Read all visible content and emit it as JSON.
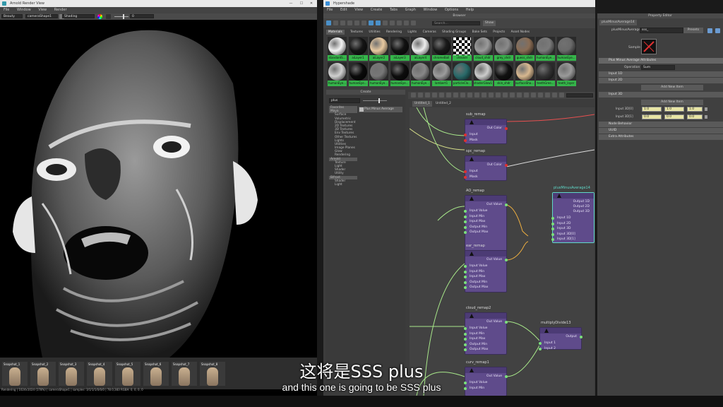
{
  "left_window": {
    "title": "Arnold Render View",
    "menu": [
      "File",
      "Window",
      "View",
      "Render"
    ],
    "toolbar": {
      "aov": "Beauty",
      "camera": "cameraShape1",
      "shading": "Shading",
      "exposure": "0"
    },
    "status": "Rendering | 1024x1024 (178%) | cameraShape1 | samples: 3/1/1/1/0/0/0 | 78.0,383 RGBA: 0, 0, 0, 0",
    "snapshots": [
      "Snapshot_1",
      "Snapshot_2",
      "Snapshot_3",
      "Snapshot_4",
      "Snapshot_5",
      "Snapshot_6",
      "Snapshot_7",
      "Snapshot_8"
    ]
  },
  "hypershade": {
    "title": "Hypershade",
    "menu": [
      "File",
      "Edit",
      "View",
      "Create",
      "Tabs",
      "Graph",
      "Window",
      "Options",
      "Help"
    ],
    "browser_title": "Browser",
    "browser_tabs": [
      "Materials",
      "Textures",
      "Utilities",
      "Rendering",
      "Lights",
      "Cameras",
      "Shading Groups",
      "Bake Sets",
      "Projects",
      "Asset Nodes"
    ],
    "search_placeholder": "Search...",
    "show_label": "Show",
    "swatches": [
      {
        "label": "standardS...",
        "color": "#f4f4f4"
      },
      {
        "label": "aiLayer1",
        "color": "#151515"
      },
      {
        "label": "aiLayer2",
        "color": "#e8c9a0"
      },
      {
        "label": "aiLayer3",
        "color": "#111111"
      },
      {
        "label": "aiLayer4",
        "color": "#eeeeee"
      },
      {
        "label": "chromeBall",
        "color": "#1a1a1a"
      },
      {
        "label": "checker",
        "color": "#ffffff"
      },
      {
        "label": "cloud_shdr",
        "color": "#9a9a9a"
      },
      {
        "label": "grey_shdr",
        "color": "#8a8a8a"
      },
      {
        "label": "guess_shdr",
        "color": "#8a6d55"
      },
      {
        "label": "humanEye...",
        "color": "#7a7a7a"
      },
      {
        "label": "humanEye...",
        "color": "#6a6a6a"
      },
      {
        "label": "humanEye...",
        "color": "#d0d0d0"
      },
      {
        "label": "humanEye...",
        "color": "#0a0a0a"
      },
      {
        "label": "humanEye...",
        "color": "#777777"
      },
      {
        "label": "humanEye...",
        "color": "#0d0d0d"
      },
      {
        "label": "humanEye...",
        "color": "#888888"
      },
      {
        "label": "lambert1",
        "color": "#9c9c9c"
      },
      {
        "label": "particleClo...",
        "color": "#2a6a6a"
      },
      {
        "label": "shaderGlow1",
        "color": "#cccccc"
      },
      {
        "label": "skin_shdr",
        "color": "#111111"
      },
      {
        "label": "surfaceSha...",
        "color": "#d8b890"
      },
      {
        "label": "teethGree...",
        "color": "#333333"
      },
      {
        "label": "teeth_layer",
        "color": "#9a9a9a"
      }
    ],
    "create_title": "Create",
    "create_search": "plus",
    "create_tree": [
      "Favorites",
      "Maya",
      "Surface",
      "Volumetric",
      "Displacement",
      "2D Textures",
      "3D Textures",
      "Env Textures",
      "Other Textures",
      "Lights",
      "Utilities",
      "Image Planes",
      "Glow",
      "Rendering",
      "Arnold",
      "Texture",
      "Light",
      "Shader",
      "Utility",
      "Bifrost",
      "Shader",
      "Light"
    ],
    "create_result": "Plus Minus Average",
    "editor_tabs": [
      "Untitled_1",
      "Untitled_2"
    ],
    "nodes": [
      {
        "title": "sub_remap",
        "rows": [
          "Input",
          "Mask"
        ],
        "out": "Out Color"
      },
      {
        "title": "spc_remap",
        "rows": [
          "Input",
          "Mask"
        ],
        "out": "Out Color"
      },
      {
        "title": "AO_remap",
        "rows": [
          "Input Value",
          "Input Min",
          "Input Max",
          "Output Min",
          "Output Max"
        ],
        "out": "Out Value"
      },
      {
        "title": "ear_remap",
        "rows": [
          "Input Value",
          "Input Min",
          "Input Max",
          "Output Min",
          "Output Max"
        ],
        "out": "Out Value"
      },
      {
        "title": "cloud_remap2",
        "rows": [
          "Input Value",
          "Input Min",
          "Input Max",
          "Output Min",
          "Output Max"
        ],
        "out": "Out Value"
      },
      {
        "title": "curv_remap1",
        "rows": [
          "Input Value",
          "Input Min"
        ],
        "out": "Out Value"
      },
      {
        "title": "multiplyDivide13",
        "rows": [
          "Input 1",
          "Input 2"
        ],
        "out": "Output"
      },
      {
        "title": "plusMinusAverage14",
        "rows": [
          "Input 1D",
          "Input 2D",
          "Input 3D",
          "Input 3D[0]",
          "Input 3D[1]"
        ],
        "outs": [
          "Output 1D",
          "Output 2D",
          "Output 3D"
        ]
      }
    ]
  },
  "property_editor": {
    "title": "Property Editor",
    "tab": "plusMinusAverage14",
    "field_label": "plusMinusAverage:",
    "field_value": "sss_",
    "presets": "Presets",
    "sample_label": "Sample",
    "section_title": "Plus Minus Average Attributes",
    "operation_label": "Operation",
    "operation_value": "Sum",
    "sub_sections": [
      "Input 1D",
      "Input 2D",
      "Input 3D"
    ],
    "add_new_item": "Add New Item",
    "input3d_rows": [
      {
        "label": "Input 3D[0]",
        "v": [
          "1.0",
          "1.0",
          "1.0"
        ]
      },
      {
        "label": "Input 3D[1]",
        "v": [
          "0.0",
          "0.0",
          "0.0"
        ]
      }
    ],
    "collapsed": [
      "Node Behavior",
      "UUID",
      "Extra Attributes"
    ]
  },
  "subtitle": {
    "zh": "这将是SSS plus",
    "en": "and this one is going to be SSS plus"
  }
}
